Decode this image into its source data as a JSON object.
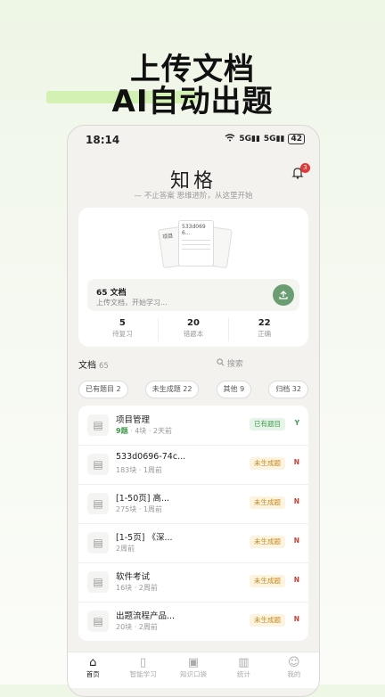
{
  "promo": {
    "line1": "上传文档",
    "line2": "AI自动出题"
  },
  "status_bar": {
    "time": "18:14",
    "signal1": "5G",
    "signal2": "5G",
    "battery": "42"
  },
  "header": {
    "title": "知格",
    "subtitle": "— 不止答案 思维进阶，从这里开始",
    "notification_count": "3"
  },
  "summary_card": {
    "paper_left": "项目",
    "paper_right_line1": "533d069",
    "paper_right_line2": "6...",
    "doc_count": "65 文档",
    "upload_hint": "上传文档，开始学习...",
    "stats": [
      {
        "value": "5",
        "label": "待复习"
      },
      {
        "value": "20",
        "label": "错题本"
      },
      {
        "value": "22",
        "label": "正确"
      }
    ]
  },
  "docs_section": {
    "label": "文档",
    "count": "65",
    "search_placeholder": "搜索"
  },
  "filters": [
    "已有题目 2",
    "未生成题 22",
    "其他 9",
    "归档 32"
  ],
  "documents": [
    {
      "title": "项目管理",
      "questions": "9题",
      "meta": "· 4块 · 2天前",
      "status": "已有题目",
      "flag": "Y",
      "ok": true
    },
    {
      "title": "533d0696-74c...",
      "questions": "",
      "meta": "183块 · 1周前",
      "status": "未生成题",
      "flag": "N",
      "ok": false
    },
    {
      "title": "[1-50页] 高...",
      "questions": "",
      "meta": "275块 · 1周前",
      "status": "未生成题",
      "flag": "N",
      "ok": false
    },
    {
      "title": "[1-5页] 《深...",
      "questions": "",
      "meta": "2周前",
      "status": "未生成题",
      "flag": "N",
      "ok": false
    },
    {
      "title": "软件考试",
      "questions": "",
      "meta": "16块 · 2周前",
      "status": "未生成题",
      "flag": "N",
      "ok": false
    },
    {
      "title": "出题流程产品...",
      "questions": "",
      "meta": "20块 · 2周前",
      "status": "未生成题",
      "flag": "N",
      "ok": false
    }
  ],
  "tabs": [
    {
      "label": "首页",
      "icon": "home-icon",
      "active": true
    },
    {
      "label": "智能学习",
      "icon": "book-icon",
      "active": false
    },
    {
      "label": "知识口袋",
      "icon": "pocket-icon",
      "active": false
    },
    {
      "label": "统计",
      "icon": "chart-icon",
      "active": false
    },
    {
      "label": "我的",
      "icon": "user-icon",
      "active": false
    }
  ],
  "colors": {
    "accent": "#6a9e72",
    "ok": "#3f9d4a",
    "warn": "#c9871a",
    "error": "#d23a2e"
  }
}
